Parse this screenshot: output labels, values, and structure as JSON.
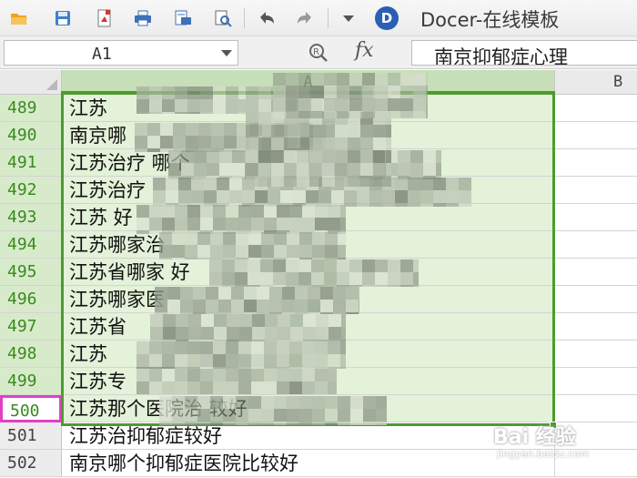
{
  "toolbar": {
    "icons": [
      "open-folder-icon",
      "save-icon",
      "export-pdf-icon",
      "print-icon",
      "print-preview-icon",
      "spell-check-icon",
      "undo-icon",
      "redo-icon",
      "dropdown-icon"
    ],
    "docer_title": "Docer-在线模板"
  },
  "formula_bar": {
    "cell_ref": "A1",
    "fx_label": "fx",
    "formula_text": "南京抑郁症心理"
  },
  "grid": {
    "col_a_header": "A",
    "col_b_header": "B",
    "rows": [
      {
        "num": "489",
        "text": "江苏",
        "state": "sel"
      },
      {
        "num": "490",
        "text": "南京哪",
        "state": "sel"
      },
      {
        "num": "491",
        "text": "江苏治疗                                   哪个",
        "state": "sel"
      },
      {
        "num": "492",
        "text": "江苏治疗",
        "state": "sel"
      },
      {
        "num": "493",
        "text": "江苏                       好",
        "state": "sel"
      },
      {
        "num": "494",
        "text": "江苏哪家治",
        "state": "sel"
      },
      {
        "num": "495",
        "text": "江苏省哪家                           好",
        "state": "sel"
      },
      {
        "num": "496",
        "text": "江苏哪家医",
        "state": "sel"
      },
      {
        "num": "497",
        "text": "江苏省",
        "state": "sel"
      },
      {
        "num": "498",
        "text": "江苏",
        "state": "sel"
      },
      {
        "num": "499",
        "text": "江苏专",
        "state": "sel"
      },
      {
        "num": "500",
        "text": "江苏那个医院治                 较好",
        "state": "active"
      },
      {
        "num": "501",
        "text": "江苏治抑郁症较好",
        "state": "plain"
      },
      {
        "num": "502",
        "text": "南京哪个抑郁症医院比较好",
        "state": "plain"
      }
    ]
  },
  "watermark": {
    "text": "Bai 经验",
    "url": "jingyan.baidu.com"
  }
}
